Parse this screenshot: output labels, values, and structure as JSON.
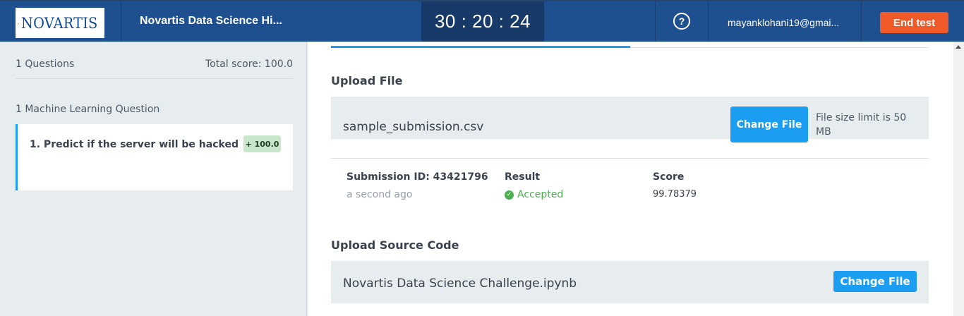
{
  "header": {
    "logo_text": "NOVARTIS",
    "test_title": "Novartis Data Science Hi...",
    "timer": "30 : 20 : 24",
    "help_symbol": "?",
    "user_email": "mayanklohani19@gmai...",
    "end_test_label": "End test"
  },
  "sidebar": {
    "questions_count": "1 Questions",
    "total_score": "Total score: 100.0",
    "section_label": "1 Machine Learning Question",
    "question": {
      "title": "1. Predict if the server will be hacked",
      "badge": "+ 100.0"
    }
  },
  "main": {
    "upload_file": {
      "title": "Upload File",
      "file_name": "sample_submission.csv",
      "change_label": "Change File",
      "limit_text": "File size limit is 50 MB"
    },
    "submission": {
      "id_label": "Submission ID: 43421796",
      "time": "a second ago",
      "result_label": "Result",
      "result_value": "Accepted",
      "score_label": "Score",
      "score_value": "99.78379"
    },
    "upload_source": {
      "title": "Upload Source Code",
      "file_name": "Novartis Data Science Challenge.ipynb",
      "change_label": "Change File"
    }
  },
  "colors": {
    "header_bg": "#1e4f8f",
    "timer_bg": "#173a68",
    "end_button": "#f05a28",
    "accent_blue": "#1b9ef2",
    "accepted_green": "#4caf50"
  }
}
